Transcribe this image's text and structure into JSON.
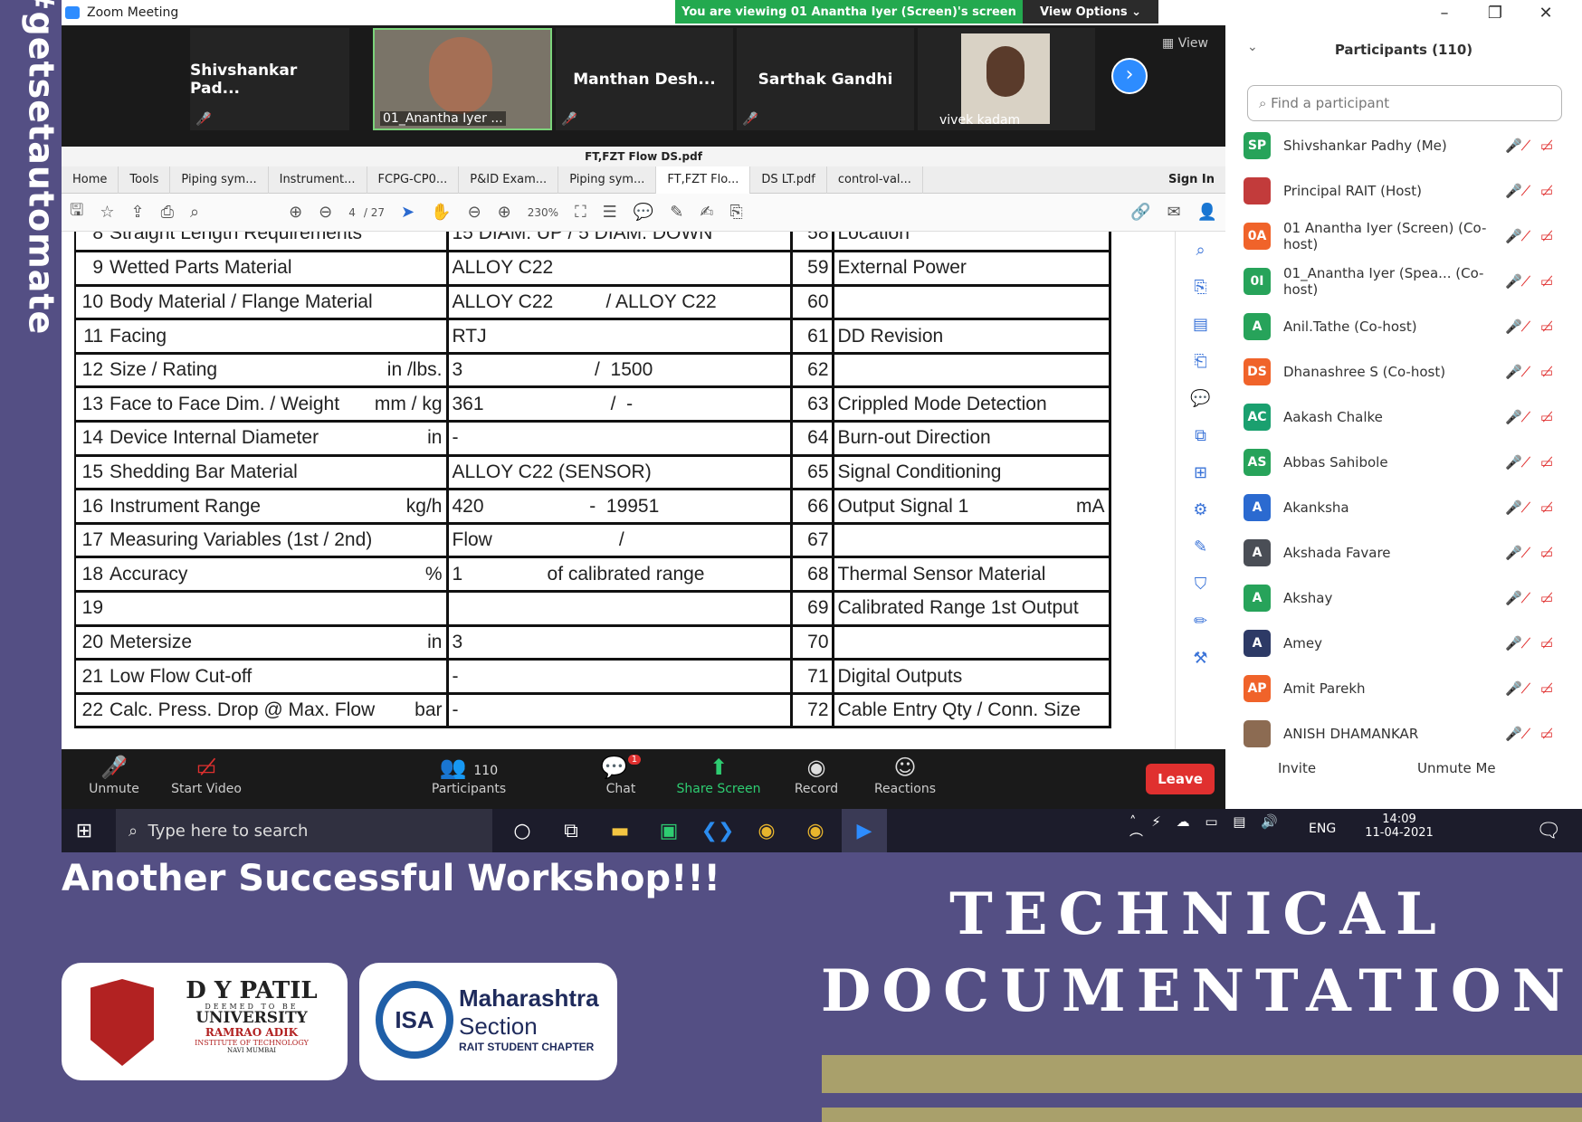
{
  "side_hashtag": "#getsetautomate",
  "window": {
    "title": "Zoom Meeting",
    "banner": "You are viewing 01 Anantha Iyer (Screen)'s screen",
    "view_options": "View Options",
    "view_label": "View",
    "min": "–",
    "max": "❐",
    "close": "✕"
  },
  "strip": [
    {
      "name": "Shivshankar  Pad..."
    },
    {
      "name": "01_Anantha Iyer ..."
    },
    {
      "name": "Manthan  Desh..."
    },
    {
      "name": "Sarthak Gandhi"
    },
    {
      "name": "vivek kadam"
    }
  ],
  "pdf": {
    "title": "FT,FZT Flow DS.pdf",
    "tabs": [
      "Home",
      "Tools",
      "Piping sym...",
      "Instrument...",
      "FCPG-CP0...",
      "P&ID Exam...",
      "Piping sym...",
      "FT,FZT Flo...",
      "DS LT.pdf",
      "control-val...",
      "Sign In"
    ],
    "page_current": "4",
    "page_total": "/ 27",
    "zoom": "230%",
    "rows": [
      {
        "n": "8",
        "label": "Straight Length Requirements",
        "unit": "",
        "mid": "15 DIAM. UP / 5 DIAM. DOWN",
        "n2": "58",
        "right": "Location",
        "runit": ""
      },
      {
        "n": "9",
        "label": "Wetted Parts Material",
        "unit": "",
        "mid": "ALLOY C22",
        "n2": "59",
        "right": "External Power",
        "runit": ""
      },
      {
        "n": "10",
        "label": "Body Material / Flange Material",
        "unit": "",
        "mid": "ALLOY C22          / ALLOY C22",
        "n2": "60",
        "right": "",
        "runit": ""
      },
      {
        "n": "11",
        "label": "Facing",
        "unit": "",
        "mid": "RTJ",
        "n2": "61",
        "right": "DD Revision",
        "runit": ""
      },
      {
        "n": "12",
        "label": "Size / Rating",
        "unit": "in  /lbs.",
        "mid": "3                         /  1500",
        "n2": "62",
        "right": "",
        "runit": ""
      },
      {
        "n": "13",
        "label": "Face to Face Dim. / Weight",
        "unit": "mm / kg",
        "mid": "361                        /  -",
        "n2": "63",
        "right": "Crippled Mode Detection",
        "runit": ""
      },
      {
        "n": "14",
        "label": "Device Internal Diameter",
        "unit": "in",
        "mid": "-",
        "n2": "64",
        "right": "Burn-out Direction",
        "runit": ""
      },
      {
        "n": "15",
        "label": "Shedding Bar Material",
        "unit": "",
        "mid": "ALLOY C22 (SENSOR)",
        "n2": "65",
        "right": "Signal Conditioning",
        "runit": ""
      },
      {
        "n": "16",
        "label": "Instrument Range",
        "unit": "kg/h",
        "mid": "420                    -  19951",
        "n2": "66",
        "right": "Output Signal 1",
        "runit": "mA"
      },
      {
        "n": "17",
        "label": "Measuring Variables (1st / 2nd)",
        "unit": "",
        "mid": "Flow                        /",
        "n2": "67",
        "right": "",
        "runit": ""
      },
      {
        "n": "18",
        "label": "Accuracy",
        "unit": "%",
        "mid": "1                of calibrated range",
        "n2": "68",
        "right": "Thermal Sensor Material",
        "runit": ""
      },
      {
        "n": "19",
        "label": "",
        "unit": "",
        "mid": "",
        "n2": "69",
        "right": "Calibrated Range 1st Output",
        "runit": ""
      },
      {
        "n": "20",
        "label": "Metersize",
        "unit": "in",
        "mid": "3",
        "n2": "70",
        "right": "",
        "runit": ""
      },
      {
        "n": "21",
        "label": "Low Flow Cut-off",
        "unit": "",
        "mid": "-",
        "n2": "71",
        "right": "Digital Outputs",
        "runit": ""
      },
      {
        "n": "22",
        "label": "Calc. Press. Drop @  Max. Flow",
        "unit": "bar",
        "mid": "-",
        "n2": "72",
        "right": "Cable Entry Qty / Conn. Size",
        "runit": ""
      }
    ]
  },
  "toolbar": {
    "unmute": "Unmute",
    "start_video": "Start Video",
    "participants": "Participants",
    "participants_count": "110",
    "chat": "Chat",
    "chat_badge": "1",
    "share": "Share Screen",
    "record": "Record",
    "reactions": "Reactions",
    "leave": "Leave"
  },
  "panel": {
    "title": "Participants (110)",
    "search_placeholder": "Find a participant",
    "people": [
      {
        "initials": "SP",
        "name": "Shivshankar Padhy (Me)",
        "color": "#27a35a"
      },
      {
        "initials": "",
        "name": "Principal RAIT (Host)",
        "color": "#c23b3b"
      },
      {
        "initials": "0A",
        "name": "01 Anantha Iyer (Screen) (Co-host)",
        "color": "#f0632a"
      },
      {
        "initials": "0I",
        "name": "01_Anantha Iyer (Spea... (Co-host)",
        "color": "#27a35a"
      },
      {
        "initials": "A",
        "name": "Anil.Tathe (Co-host)",
        "color": "#27a35a"
      },
      {
        "initials": "DS",
        "name": "Dhanashree S (Co-host)",
        "color": "#f0632a"
      },
      {
        "initials": "AC",
        "name": "Aakash Chalke",
        "color": "#1aa06f"
      },
      {
        "initials": "AS",
        "name": "Abbas Sahibole",
        "color": "#27a35a"
      },
      {
        "initials": "A",
        "name": "Akanksha",
        "color": "#2b6ad0"
      },
      {
        "initials": "A",
        "name": "Akshada Favare",
        "color": "#4a4e56"
      },
      {
        "initials": "A",
        "name": "Akshay",
        "color": "#27a35a"
      },
      {
        "initials": "A",
        "name": "Amey",
        "color": "#2d3a66"
      },
      {
        "initials": "AP",
        "name": "Amit Parekh",
        "color": "#f0632a"
      },
      {
        "initials": "",
        "name": "ANISH DHAMANKAR",
        "color": "#8c6b52"
      }
    ],
    "invite": "Invite",
    "unmute_me": "Unmute Me"
  },
  "taskbar": {
    "search": "Type here to search",
    "lang": "ENG",
    "time": "14:09",
    "date": "11-04-2021"
  },
  "poster": {
    "tagline": "Another Successful Workshop!!!",
    "heading_line1": "TECHNICAL",
    "heading_line2": "DOCUMENTATION",
    "logo1_name": "D Y PATIL",
    "logo1_sub1": "DEEMED TO BE",
    "logo1_sub2": "UNIVERSITY",
    "logo1_sub3": "RAMRAO ADIK",
    "logo1_sub4": "INSTITUTE OF TECHNOLOGY",
    "logo1_sub5": "NAVI MUMBAI",
    "logo2_mark": "ISA",
    "logo2_l1": "Maharashtra",
    "logo2_l2": "Section",
    "logo2_l3": "RAIT STUDENT CHAPTER"
  }
}
